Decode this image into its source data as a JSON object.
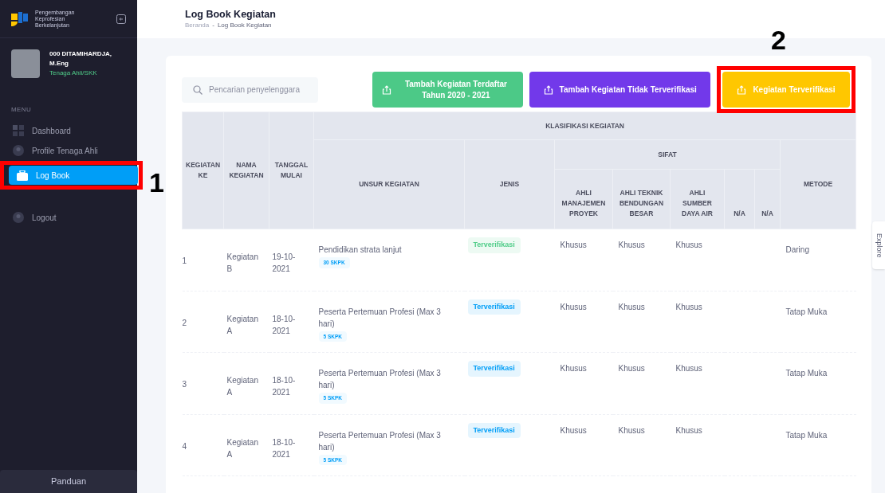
{
  "sidebar": {
    "logo_lines": [
      "Pengembangan",
      "Keprofesian",
      "Berkelanjutan"
    ],
    "user": {
      "name": "000 DITAMIHARDJA, M.Eng",
      "role": "Tenaga Ahli/SKK"
    },
    "menu_label": "MENU",
    "menu": [
      {
        "label": "Dashboard",
        "kind": "grid",
        "selected": false
      },
      {
        "label": "Profile Tenaga Ahli",
        "kind": "person",
        "selected": false
      },
      {
        "label": "Log Book",
        "kind": "briefcase",
        "selected": true
      },
      {
        "label": "Logout",
        "kind": "person",
        "selected": false
      }
    ],
    "guide_button": "Panduan"
  },
  "header": {
    "title": "Log Book Kegiatan",
    "breadcrumb": [
      "Beranda",
      "-",
      "Log Book Kegiatan"
    ]
  },
  "toolbar": {
    "search": {
      "placeholder": "Pencarian penyelenggara"
    },
    "buttons": [
      {
        "label": "Tambah Kegiatan Terdaftar Tahun 2020 - 2021",
        "color": "#4cc987"
      },
      {
        "label": "Tambah Kegiatan Tidak Terverifikasi",
        "color": "#7239ea"
      },
      {
        "label": "Kegiatan Terverifikasi",
        "color": "#ffc700"
      }
    ]
  },
  "table": {
    "columns": [
      "KEGIATAN KE",
      "NAMA KEGIATAN",
      "TANGGAL MULAI"
    ],
    "group": "KLASIFIKASI KEGIATAN",
    "unsur": "UNSUR KEGIATAN",
    "jenis": "JENIS",
    "sifat": "SIFAT",
    "sifat_columns": [
      "AHLI MANAJEMEN PROYEK",
      "AHLI TEKNIK BENDUNGAN BESAR",
      "AHLI SUMBER DAYA AIR",
      "N/A",
      "N/A"
    ],
    "metode": "METODE",
    "rows": [
      {
        "no": "1",
        "nama": "Kegiatan B",
        "tanggal": "19-10-2021",
        "unsur": "Pendidikan strata lanjut",
        "skpk": "30 SKPK",
        "jenis": {
          "label": "Terverifikasi",
          "color": "#50cd89"
        },
        "sifat": [
          "Khusus",
          "Khusus",
          "Khusus"
        ],
        "metode": "Daring"
      },
      {
        "no": "2",
        "nama": "Kegiatan A",
        "tanggal": "18-10-2021",
        "unsur": "Peserta Pertemuan Profesi (Max 3 hari)",
        "skpk": "5 SKPK",
        "jenis": {
          "label": "Terverifikasi",
          "color": "#009ef7"
        },
        "sifat": [
          "Khusus",
          "Khusus",
          "Khusus"
        ],
        "metode": "Tatap Muka"
      },
      {
        "no": "3",
        "nama": "Kegiatan A",
        "tanggal": "18-10-2021",
        "unsur": "Peserta Pertemuan Profesi (Max 3 hari)",
        "skpk": "5 SKPK",
        "jenis": {
          "label": "Terverifikasi",
          "color": "#009ef7"
        },
        "sifat": [
          "Khusus",
          "Khusus",
          "Khusus"
        ],
        "metode": "Tatap Muka"
      },
      {
        "no": "4",
        "nama": "Kegiatan A",
        "tanggal": "18-10-2021",
        "unsur": "Peserta Pertemuan Profesi (Max 3 hari)",
        "skpk": "5 SKPK",
        "jenis": {
          "label": "Terverifikasi",
          "color": "#009ef7"
        },
        "sifat": [
          "Khusus",
          "Khusus",
          "Khusus"
        ],
        "metode": "Tatap Muka"
      }
    ]
  },
  "explore_tab": "Explore",
  "annotations": [
    {
      "number": "1"
    },
    {
      "number": "2"
    }
  ]
}
